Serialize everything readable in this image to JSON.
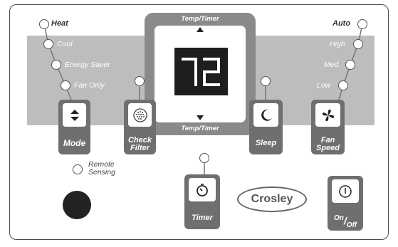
{
  "display": {
    "temperature": "72"
  },
  "temp_timer": {
    "top_label": "Temp/Timer",
    "bottom_label": "Temp/Timer"
  },
  "modes": [
    {
      "label": "Heat"
    },
    {
      "label": "Cool"
    },
    {
      "label": "Energy Saver"
    },
    {
      "label": "Fan Only"
    }
  ],
  "fan_speeds": [
    {
      "label": "Auto"
    },
    {
      "label": "High"
    },
    {
      "label": "Med"
    },
    {
      "label": "Low"
    }
  ],
  "buttons": {
    "mode": "Mode",
    "check_filter_line1": "Check",
    "check_filter_line2": "Filter",
    "sleep": "Sleep",
    "fan_speed_line1": "Fan",
    "fan_speed_line2": "Speed",
    "timer": "Timer",
    "on_off_on": "On",
    "on_off_off": "Off"
  },
  "remote_sensing": {
    "line1": "Remote",
    "line2": "Sensing"
  },
  "brand": "Crosley"
}
